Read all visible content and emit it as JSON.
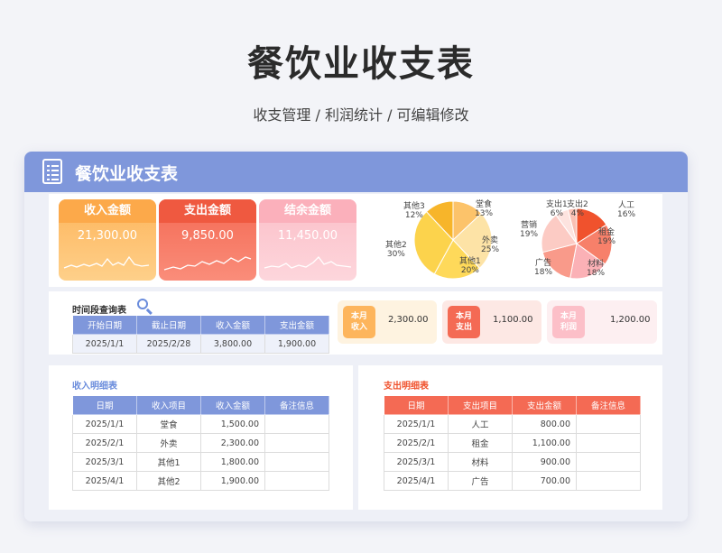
{
  "page": {
    "title": "餐饮业收支表",
    "subtitle": "收支管理 /  利润统计 /  可编辑修改"
  },
  "card": {
    "title": "餐饮业收支表"
  },
  "kpis": [
    {
      "label": "收入金额",
      "value": "21,300.00",
      "color": "#fdb55c"
    },
    {
      "label": "支出金额",
      "value": "9,850.00",
      "color": "#f46a54"
    },
    {
      "label": "结余金额",
      "value": "11,450.00",
      "color": "#fcbfc8"
    }
  ],
  "income_pie": {
    "slices": [
      {
        "name": "堂食",
        "pct": "13%",
        "value": 13,
        "color": "#fcc36a"
      },
      {
        "name": "外卖",
        "pct": "25%",
        "value": 25,
        "color": "#fde3a6"
      },
      {
        "name": "其他1",
        "pct": "20%",
        "value": 20,
        "color": "#fed95a"
      },
      {
        "name": "其他2",
        "pct": "30%",
        "value": 30,
        "color": "#fcd34c"
      },
      {
        "name": "其他3",
        "pct": "12%",
        "value": 12,
        "color": "#f7b52a"
      }
    ]
  },
  "expense_pie": {
    "slices": [
      {
        "name": "人工",
        "pct": "16%",
        "value": 16,
        "color": "#f0522d"
      },
      {
        "name": "租金",
        "pct": "19%",
        "value": 19,
        "color": "#f7806a"
      },
      {
        "name": "材料",
        "pct": "18%",
        "value": 18,
        "color": "#fbb1b6"
      },
      {
        "name": "广告",
        "pct": "18%",
        "value": 18,
        "color": "#f99a8a"
      },
      {
        "name": "营销",
        "pct": "19%",
        "value": 19,
        "color": "#fccbc4"
      },
      {
        "name": "支出1",
        "pct": "6%",
        "value": 6,
        "color": "#fde3df"
      },
      {
        "name": "支出2",
        "pct": "4%",
        "value": 4,
        "color": "#f9c0b4"
      }
    ]
  },
  "period_query": {
    "title": "时间段查询表",
    "headers": [
      "开始日期",
      "截止日期",
      "收入金额",
      "支出金额"
    ],
    "row": [
      "2025/1/1",
      "2025/2/28",
      "3,800.00",
      "1,900.00"
    ]
  },
  "monthly": [
    {
      "badge_line1": "本月",
      "badge_line2": "收入",
      "value": "2,300.00",
      "badge_color": "#fdb55c",
      "bg": "#fef3e0"
    },
    {
      "badge_line1": "本月",
      "badge_line2": "支出",
      "value": "1,100.00",
      "badge_color": "#f46a54",
      "bg": "#fde8e4"
    },
    {
      "badge_line1": "本月",
      "badge_line2": "利润",
      "value": "1,200.00",
      "badge_color": "#fcbfc8",
      "bg": "#fdeff1"
    }
  ],
  "income_detail": {
    "title": "收入明细表",
    "headers": [
      "日期",
      "收入项目",
      "收入金额",
      "备注信息"
    ],
    "rows": [
      [
        "2025/1/1",
        "堂食",
        "1,500.00",
        ""
      ],
      [
        "2025/2/1",
        "外卖",
        "2,300.00",
        ""
      ],
      [
        "2025/3/1",
        "其他1",
        "1,800.00",
        ""
      ],
      [
        "2025/4/1",
        "其他2",
        "1,900.00",
        ""
      ]
    ]
  },
  "expense_detail": {
    "title": "支出明细表",
    "headers": [
      "日期",
      "支出项目",
      "支出金额",
      "备注信息"
    ],
    "rows": [
      [
        "2025/1/1",
        "人工",
        "800.00",
        ""
      ],
      [
        "2025/2/1",
        "租金",
        "1,100.00",
        ""
      ],
      [
        "2025/3/1",
        "材料",
        "900.00",
        ""
      ],
      [
        "2025/4/1",
        "广告",
        "700.00",
        ""
      ]
    ]
  }
}
